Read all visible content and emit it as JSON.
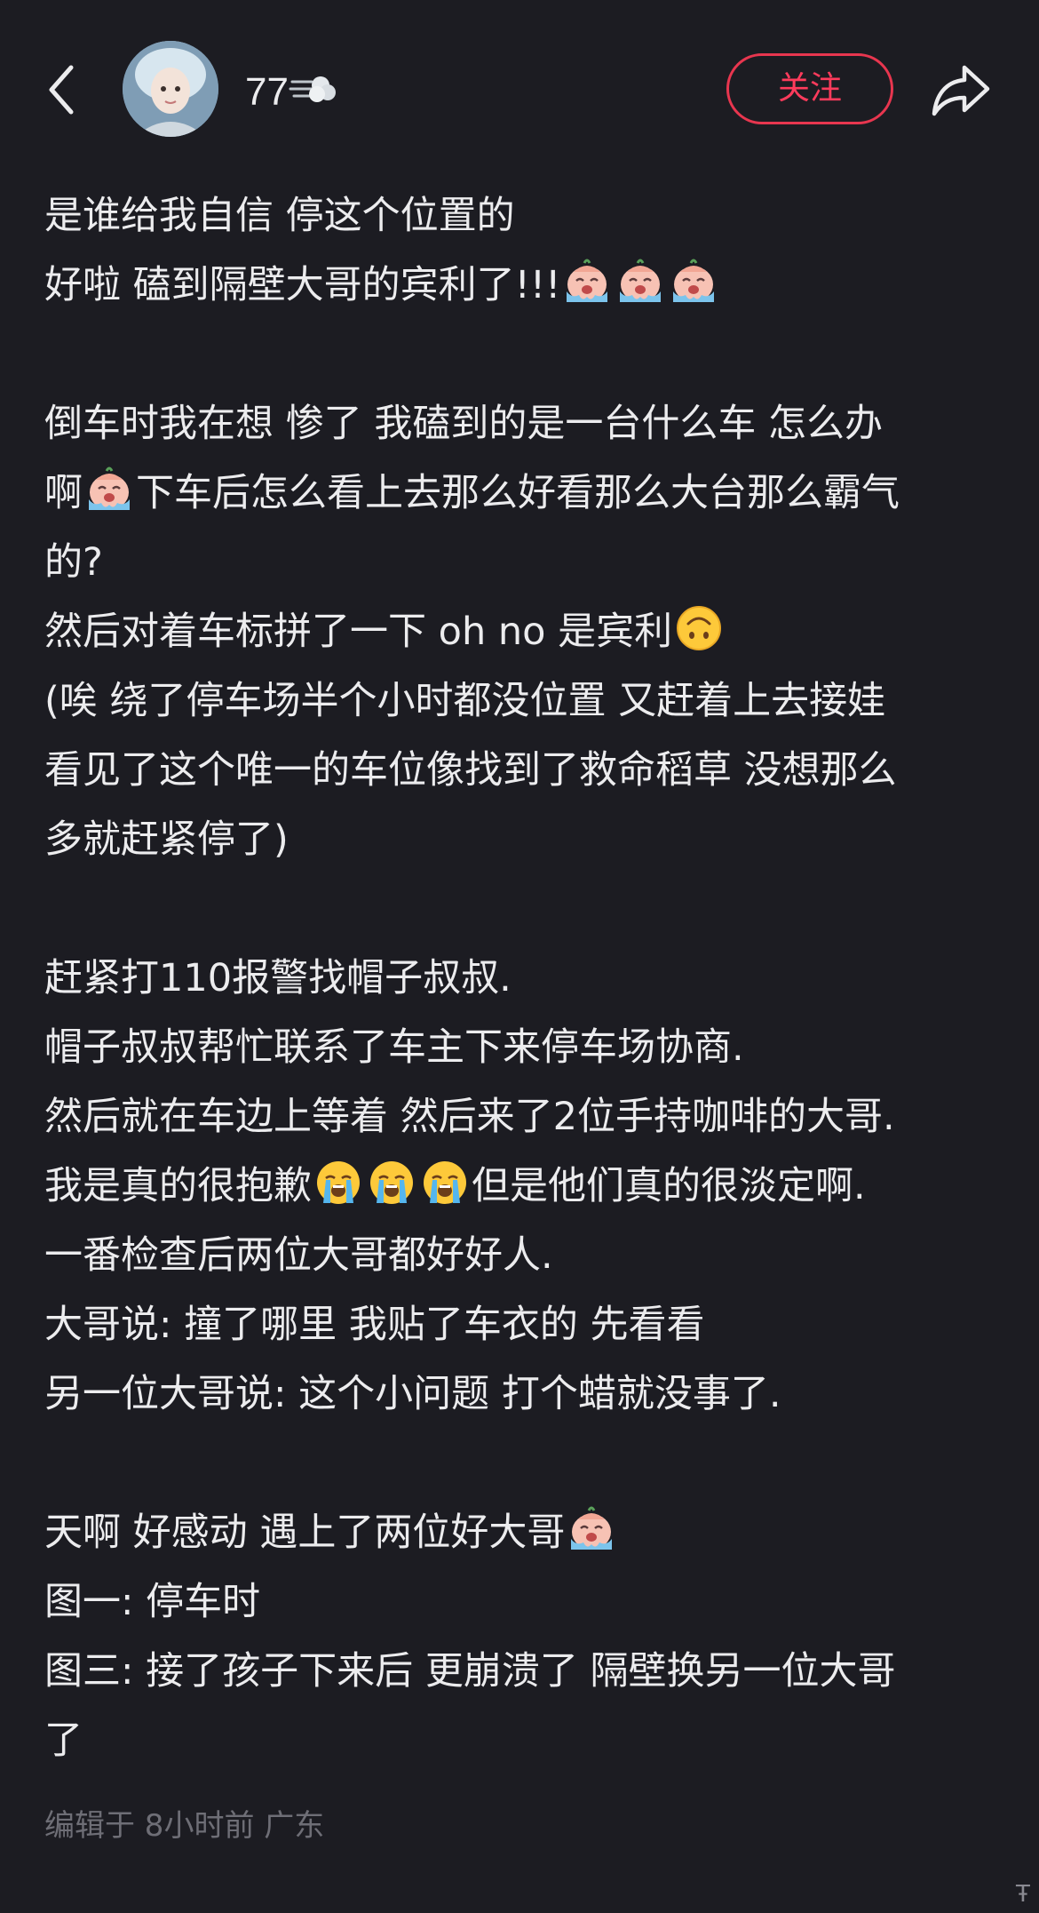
{
  "header": {
    "username": "77",
    "follow_label": "关注"
  },
  "post": {
    "lines": [
      {
        "text": "是谁给我自信 停这个位置的"
      },
      {
        "text": "好啦 磕到隔壁大哥的宾利了!!!",
        "after_emoji": [
          "crying-baby-emoji",
          "crying-baby-emoji",
          "crying-baby-emoji"
        ]
      },
      {
        "text": ""
      },
      {
        "text": "倒车时我在想 惨了 我磕到的是一台什么车  怎么办"
      },
      {
        "text": "啊",
        "after_emoji": [
          "crying-baby-emoji"
        ],
        "tail": "下车后怎么看上去那么好看那么大台那么霸气"
      },
      {
        "text": "的?"
      },
      {
        "text": "然后对着车标拼了一下 oh no 是宾利",
        "after_emoji": [
          "upside-down-face-emoji"
        ]
      },
      {
        "text": "(唉 绕了停车场半个小时都没位置 又赶着上去接娃"
      },
      {
        "text": "看见了这个唯一的车位像找到了救命稻草 没想那么"
      },
      {
        "text": "多就赶紧停了)"
      },
      {
        "text": ""
      },
      {
        "text": "赶紧打110报警找帽子叔叔."
      },
      {
        "text": "帽子叔叔帮忙联系了车主下来停车场协商."
      },
      {
        "text": "然后就在车边上等着 然后来了2位手持咖啡的大哥."
      },
      {
        "text": "我是真的很抱歉",
        "after_emoji": [
          "loudly-crying-emoji",
          "loudly-crying-emoji",
          "loudly-crying-emoji"
        ],
        "tail": "但是他们真的很淡定啊."
      },
      {
        "text": "一番检查后两位大哥都好好人."
      },
      {
        "text": "大哥说: 撞了哪里 我贴了车衣的 先看看"
      },
      {
        "text": "另一位大哥说: 这个小问题 打个蜡就没事了."
      },
      {
        "text": ""
      },
      {
        "text": "天啊 好感动 遇上了两位好大哥",
        "after_emoji": [
          "crying-baby-emoji"
        ]
      },
      {
        "text": "图一: 停车时"
      },
      {
        "text": "图三: 接了孩子下来后 更崩溃了 隔壁换另一位大哥"
      },
      {
        "text": "了"
      }
    ],
    "meta": "编辑于 8小时前 广东"
  },
  "corner_mark": "Ŧ",
  "colors": {
    "background": "#1c1c22",
    "text": "#ececee",
    "accent": "#e8364f",
    "meta": "#6e6e76"
  }
}
